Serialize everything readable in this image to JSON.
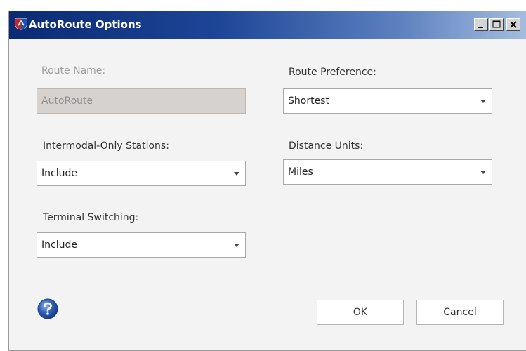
{
  "window": {
    "title": "AutoRoute Options",
    "app_icon": "autoroute-app-icon",
    "controls": {
      "minimize_icon": "minimize-icon",
      "maximize_icon": "maximize-icon",
      "close_icon": "close-icon"
    }
  },
  "form": {
    "route_name": {
      "label": "Route Name:",
      "value": "AutoRoute",
      "enabled": false
    },
    "route_preference": {
      "label": "Route Preference:",
      "value": "Shortest"
    },
    "intermodal_only_stations": {
      "label": "Intermodal-Only Stations:",
      "value": "Include"
    },
    "distance_units": {
      "label": "Distance Units:",
      "value": "Miles"
    },
    "terminal_switching": {
      "label": "Terminal Switching:",
      "value": "Include"
    }
  },
  "footer": {
    "help_icon": "help-icon",
    "ok_label": "OK",
    "cancel_label": "Cancel"
  },
  "colors": {
    "titlebar_start": "#0b2a73",
    "titlebar_end": "#a4bddf",
    "dialog_background": "#f3f3f3",
    "disabled_field": "#d6d2cf",
    "help_blue": "#2f5fb5"
  }
}
